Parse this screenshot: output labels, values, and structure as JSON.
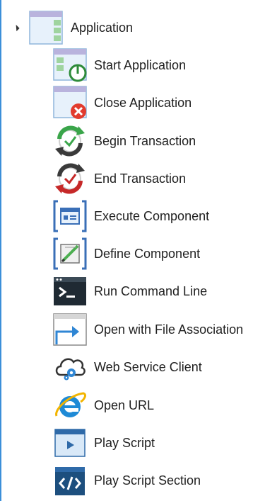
{
  "tree": {
    "root": {
      "label": "Application",
      "icon": "application-icon",
      "expanded": true
    },
    "items": [
      {
        "label": "Start Application",
        "icon": "start-application-icon"
      },
      {
        "label": "Close Application",
        "icon": "close-application-icon"
      },
      {
        "label": "Begin Transaction",
        "icon": "begin-transaction-icon"
      },
      {
        "label": "End Transaction",
        "icon": "end-transaction-icon"
      },
      {
        "label": "Execute Component",
        "icon": "execute-component-icon"
      },
      {
        "label": "Define Component",
        "icon": "define-component-icon"
      },
      {
        "label": "Run Command Line",
        "icon": "command-line-icon"
      },
      {
        "label": "Open with File Association",
        "icon": "file-association-icon"
      },
      {
        "label": "Web Service Client",
        "icon": "web-service-icon"
      },
      {
        "label": "Open URL",
        "icon": "browser-icon"
      },
      {
        "label": "Play Script",
        "icon": "play-script-icon"
      },
      {
        "label": "Play Script Section",
        "icon": "script-section-icon"
      }
    ]
  },
  "colors": {
    "accent_border": "#3c8fd9",
    "window_purple": "#b9b3dd",
    "window_blue": "#cfe4f7",
    "window_green": "#9fd49f",
    "power_green": "#2e8b3a",
    "close_red": "#e23b2e",
    "cycle_green": "#3aa54a",
    "cycle_red": "#c62828",
    "bracket_blue": "#3a6fb7",
    "terminal_dark": "#1f2a33",
    "ie_blue": "#1e8ad6",
    "script_blue": "#2f6aa8",
    "script_dark": "#1d4f7e"
  }
}
